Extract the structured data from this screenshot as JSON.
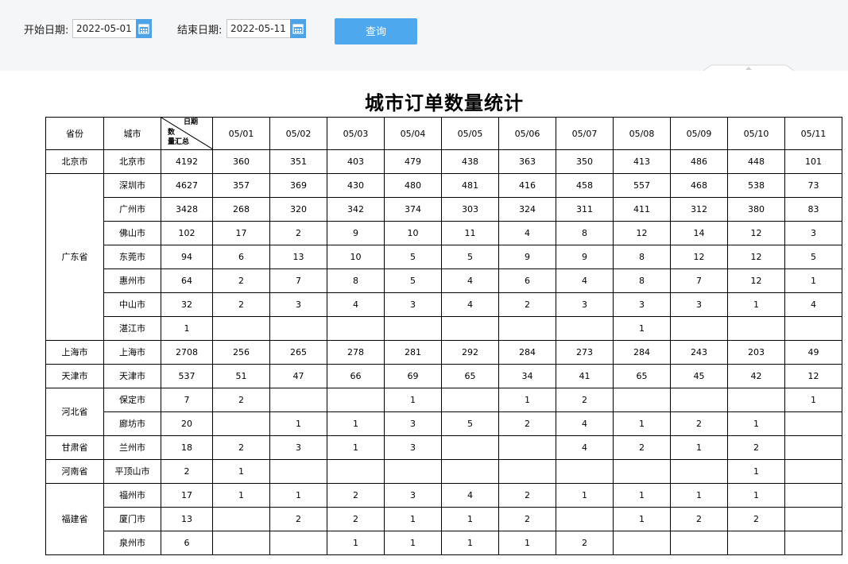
{
  "filters": {
    "start_label": "开始日期:",
    "start_value": "2022-05-01",
    "end_label": "结束日期:",
    "end_value": "2022-05-11",
    "query_label": "查询"
  },
  "report": {
    "title": "城市订单数量统计",
    "header": {
      "province": "省份",
      "city": "城市",
      "corner_top": "日期",
      "corner_mid": "数",
      "corner_bottom": "量汇总",
      "dates": [
        "05/01",
        "05/02",
        "05/03",
        "05/04",
        "05/05",
        "05/06",
        "05/07",
        "05/08",
        "05/09",
        "05/10",
        "05/11"
      ]
    },
    "groups": [
      {
        "province": "北京市",
        "cities": [
          {
            "name": "北京市",
            "total": "4192",
            "values": [
              "360",
              "351",
              "403",
              "479",
              "438",
              "363",
              "350",
              "413",
              "486",
              "448",
              "101"
            ]
          }
        ]
      },
      {
        "province": "广东省",
        "cities": [
          {
            "name": "深圳市",
            "total": "4627",
            "values": [
              "357",
              "369",
              "430",
              "480",
              "481",
              "416",
              "458",
              "557",
              "468",
              "538",
              "73"
            ]
          },
          {
            "name": "广州市",
            "total": "3428",
            "values": [
              "268",
              "320",
              "342",
              "374",
              "303",
              "324",
              "311",
              "411",
              "312",
              "380",
              "83"
            ]
          },
          {
            "name": "佛山市",
            "total": "102",
            "values": [
              "17",
              "2",
              "9",
              "10",
              "11",
              "4",
              "8",
              "12",
              "14",
              "12",
              "3"
            ]
          },
          {
            "name": "东莞市",
            "total": "94",
            "values": [
              "6",
              "13",
              "10",
              "5",
              "5",
              "9",
              "9",
              "8",
              "12",
              "12",
              "5"
            ]
          },
          {
            "name": "惠州市",
            "total": "64",
            "values": [
              "2",
              "7",
              "8",
              "5",
              "4",
              "6",
              "4",
              "8",
              "7",
              "12",
              "1"
            ]
          },
          {
            "name": "中山市",
            "total": "32",
            "values": [
              "2",
              "3",
              "4",
              "3",
              "4",
              "2",
              "3",
              "3",
              "3",
              "1",
              "4"
            ]
          },
          {
            "name": "湛江市",
            "total": "1",
            "values": [
              "",
              "",
              "",
              "",
              "",
              "",
              "",
              "1",
              "",
              "",
              ""
            ]
          }
        ]
      },
      {
        "province": "上海市",
        "cities": [
          {
            "name": "上海市",
            "total": "2708",
            "values": [
              "256",
              "265",
              "278",
              "281",
              "292",
              "284",
              "273",
              "284",
              "243",
              "203",
              "49"
            ]
          }
        ]
      },
      {
        "province": "天津市",
        "cities": [
          {
            "name": "天津市",
            "total": "537",
            "values": [
              "51",
              "47",
              "66",
              "69",
              "65",
              "34",
              "41",
              "65",
              "45",
              "42",
              "12"
            ]
          }
        ]
      },
      {
        "province": "河北省",
        "cities": [
          {
            "name": "保定市",
            "total": "7",
            "values": [
              "2",
              "",
              "",
              "1",
              "",
              "1",
              "2",
              "",
              "",
              "",
              "1"
            ]
          },
          {
            "name": "廊坊市",
            "total": "20",
            "values": [
              "",
              "1",
              "1",
              "3",
              "5",
              "2",
              "4",
              "1",
              "2",
              "1",
              ""
            ]
          }
        ]
      },
      {
        "province": "甘肃省",
        "cities": [
          {
            "name": "兰州市",
            "total": "18",
            "values": [
              "2",
              "3",
              "1",
              "3",
              "",
              "",
              "4",
              "2",
              "1",
              "2",
              ""
            ]
          }
        ]
      },
      {
        "province": "河南省",
        "cities": [
          {
            "name": "平顶山市",
            "total": "2",
            "values": [
              "1",
              "",
              "",
              "",
              "",
              "",
              "",
              "",
              "",
              "1",
              ""
            ]
          }
        ]
      },
      {
        "province": "福建省",
        "cities": [
          {
            "name": "福州市",
            "total": "17",
            "values": [
              "1",
              "1",
              "2",
              "3",
              "4",
              "2",
              "1",
              "1",
              "1",
              "1",
              ""
            ]
          },
          {
            "name": "厦门市",
            "total": "13",
            "values": [
              "",
              "2",
              "2",
              "1",
              "1",
              "2",
              "",
              "1",
              "2",
              "2",
              ""
            ]
          },
          {
            "name": "泉州市",
            "total": "6",
            "values": [
              "",
              "",
              "1",
              "1",
              "1",
              "1",
              "2",
              "",
              "",
              "",
              ""
            ]
          }
        ]
      }
    ]
  },
  "colors": {
    "accent": "#4ea8ee",
    "calendar_icon_bg": "#4ea3e6",
    "toolbar_bg": "#f5f6f8"
  }
}
